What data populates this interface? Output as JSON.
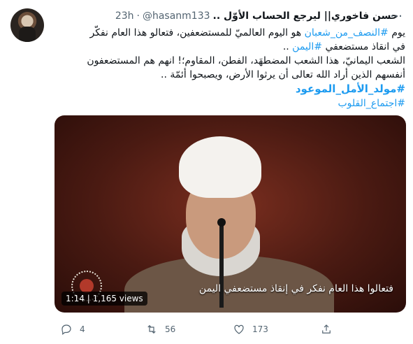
{
  "tweet": {
    "display_name": "حسن فاخوري|| ليرجع الحساب الأوّل ..",
    "handle": "@hasanm133",
    "separator": "·",
    "time": "23h",
    "more_label": "…",
    "line1_a": "يوم ",
    "line1_tag": "#النصف_من_شعبان",
    "line1_b": " هو اليوم العالميّ للمستضعفين، فتعالو هذا العام نفكّر",
    "line2_a": "في انقاذ مستضعفي ",
    "line2_tag": "#اليمن",
    "line2_b": " ..",
    "line3": "الشعب اليمانيّ، هذا الشعب المضطهَد، الفطن، المقاوم؛! انهم هم المستضعفون",
    "line4": "أنفسهم الذين أراد الله تعالى أن يرثوا الأرض، ويصبحوا أئمّة ..",
    "tag_bold": "#مولد_الأمل_الموعود",
    "tag_last": "#اجتماع_القلوب"
  },
  "media": {
    "subtitle": "فتعالوا هذا العام نفكر في إنقاذ مستضعفي اليمن",
    "duration_views": "1:14 | 1,165 views"
  },
  "actions": {
    "reply_count": "4",
    "retweet_count": "56",
    "like_count": "173",
    "icons": [
      "reply-icon",
      "retweet-icon",
      "like-icon",
      "share-icon"
    ]
  }
}
